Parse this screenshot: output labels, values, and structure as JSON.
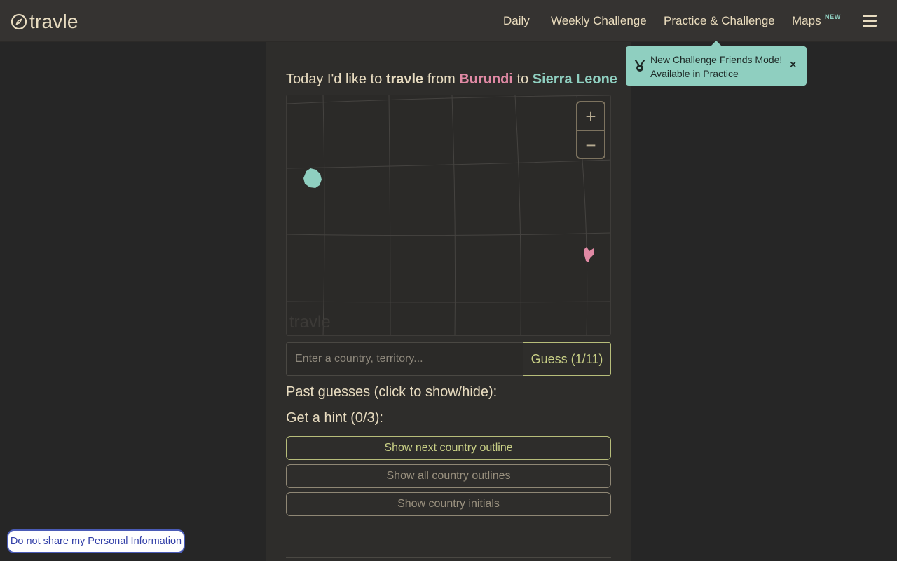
{
  "header": {
    "logo_text": "travle",
    "logo_icon": "compass-icon",
    "nav": [
      {
        "label": "Daily"
      },
      {
        "label": "Weekly Challenge"
      },
      {
        "label": "Practice & Challenge"
      },
      {
        "label": "Maps"
      }
    ],
    "maps_badge": "NEW",
    "menu_icon": "hamburger-menu-icon"
  },
  "toast": {
    "line1": "New Challenge Friends Mode!",
    "line2": "Available in Practice",
    "icon": "medal-icon",
    "close": "×"
  },
  "game": {
    "headline_prefix": "Today I'd like to",
    "headline_brand": "travle",
    "headline_from": "from",
    "from_country": "Burundi",
    "headline_to": "to",
    "to_country": "Sierra Leone",
    "colors": {
      "from": "#e089a4",
      "to": "#8fcfc0",
      "accent": "#c9d086"
    }
  },
  "map": {
    "watermark": "travle",
    "zoom_in": "+",
    "zoom_out": "−"
  },
  "guess": {
    "placeholder": "Enter a country, territory...",
    "value": "",
    "button_label": "Guess (1/11)"
  },
  "past_guesses_label": "Past guesses (click to show/hide):",
  "hint_label": "Get a hint (0/3):",
  "hints": [
    {
      "label": "Show next country outline"
    },
    {
      "label": "Show all country outlines"
    },
    {
      "label": "Show country initials"
    }
  ],
  "privacy_button": "Do not share my Personal Information"
}
